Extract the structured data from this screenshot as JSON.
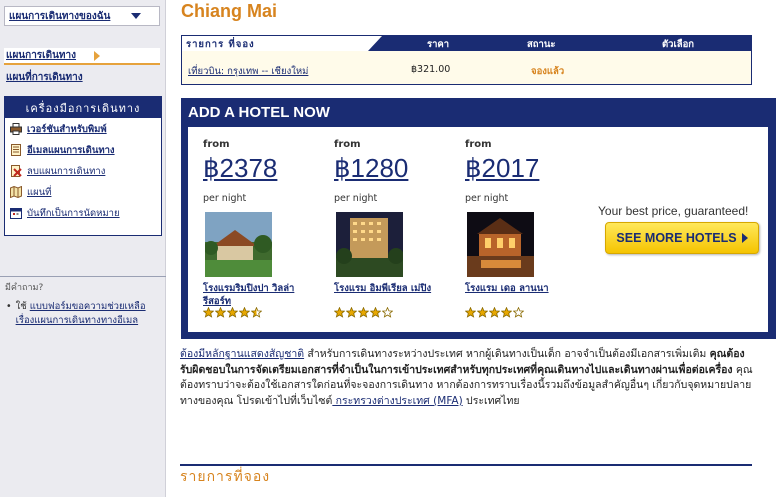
{
  "sidebar": {
    "trip_dropdown": "แผนการเดินทางของฉัน",
    "nav_plan": "แผนการเดินทาง",
    "nav_map": "แผนที่การเดินทาง",
    "tools_title": "เครื่องมือการเดินทาง",
    "tools": [
      {
        "label": "เวอร์ชันสำหรับพิมพ์",
        "icon": "printer-icon"
      },
      {
        "label": "อีเมลแผนการเดินทาง",
        "icon": "document-icon"
      },
      {
        "label": "ลบแผนการเดินทาง",
        "icon": "delete-icon"
      },
      {
        "label": "แผนที่",
        "icon": "map-icon"
      },
      {
        "label": "บันทึกเป็นการนัดหมาย",
        "icon": "calendar-icon"
      }
    ],
    "faq_title": "มีคำถาม?",
    "faq_bullet": "•",
    "faq_prefix": "ใช้",
    "faq_link": "แบบฟอร์มขอความช่วยเหลือเรื่องแผนการเดินทางทางอีเมล"
  },
  "main": {
    "city": "Chiang Mai",
    "reservations": {
      "headers": [
        "รายการ ที่จอง",
        "ราคา",
        "สถานะ",
        "ตัวเลือก"
      ],
      "row": {
        "item": "เที่ยวบิน: กรุงเทพ -- เชียงใหม่",
        "price": "฿321.00",
        "status": "จองแล้ว"
      }
    },
    "hotel_panel": {
      "title": "ADD A HOTEL NOW",
      "hotels": [
        {
          "from": "from",
          "price": "฿2378",
          "per_night": "per night",
          "name": "โรงแรมริมปิงปา วิลล่า รีสอร์ท",
          "stars": 4.5
        },
        {
          "from": "from",
          "price": "฿1280",
          "per_night": "per night",
          "name": "โรงแรม อิมพีเรียล เม่ปิง",
          "stars": 4
        },
        {
          "from": "from",
          "price": "฿2017",
          "per_night": "per night",
          "name": "โรงแรม เดอ ลานนา",
          "stars": 4
        }
      ],
      "best_price": "Your best price, guaranteed!",
      "see_more": "SEE MORE HOTELS"
    },
    "notice": {
      "link1": "ต้องมีหลักฐานแสดงสัญชาติ",
      "text1": " สำหรับการเดินทางระหว่างประเทศ หากผู้เดินทางเป็นเด็ก อาจจำเป็นต้องมีเอกสารเพิ่มเติม ",
      "bold1": "คุณต้องรับผิดชอบในการจัดเตรียมเอกสารที่จำเป็นในการเข้าประเทศสำหรับทุกประเทศที่คุณเดินทางไปและเดินทางผ่านเพื่อต่อเครื่อง",
      "text2": " คุณต้องทราบว่าจะต้องใช้เอกสารใดก่อนที่จะจองการเดินทาง หากต้องการทราบเรื่องนี้รวมถึงข้อมูลสำคัญอื่นๆ เกี่ยวกับจุดหมายปลายทางของคุณ โปรดเข้าไปที่เว็บไซต์",
      "link2": " กระทรวงต่างประเทศ (MFA)",
      "text3": " ประเทศไทย"
    },
    "bottom_heading": "รายการที่จอง"
  },
  "colors": {
    "navy": "#1a2c73",
    "orange": "#d7841f",
    "yellow_button": "#f5c400",
    "cream": "#fffbea",
    "sidebar_bg": "#ebebf0"
  }
}
